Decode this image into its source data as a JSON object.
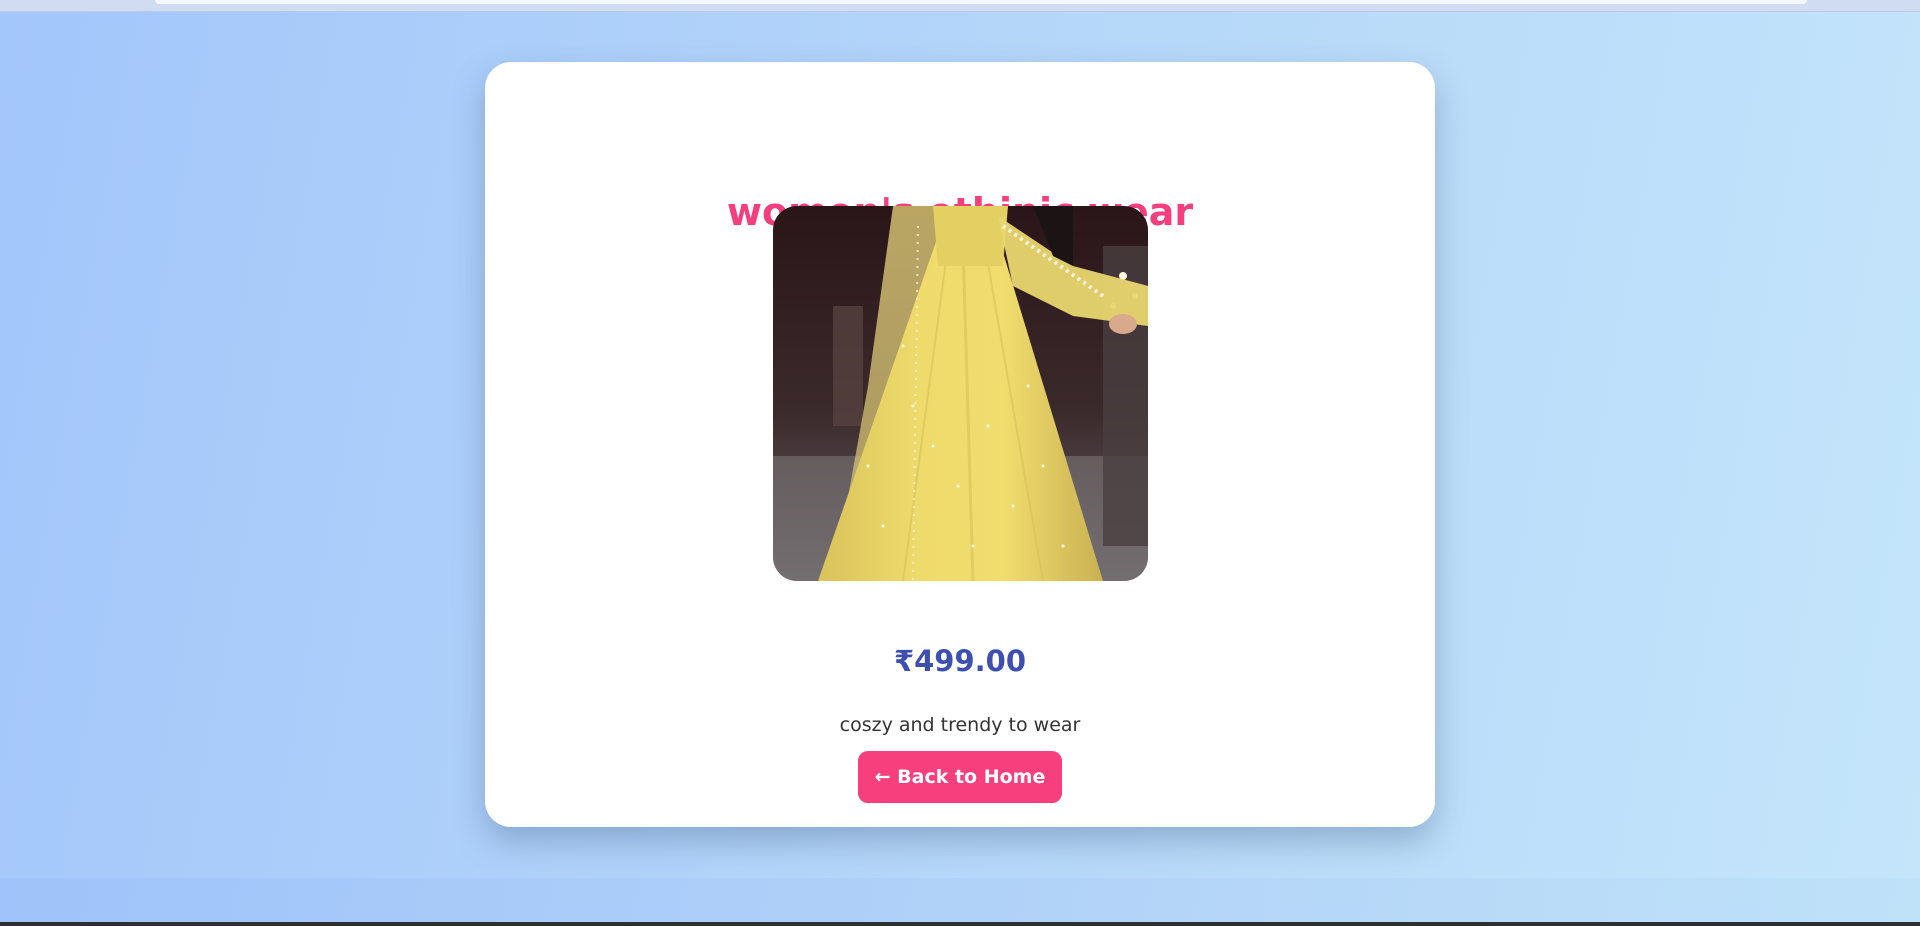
{
  "product": {
    "title": "women's ethinic wear",
    "price": "₹499.00",
    "description": "coszy and trendy to wear",
    "image_alt": "yellow anarkali dress with dupatta"
  },
  "actions": {
    "back_label": "← Back to Home"
  },
  "colors": {
    "title": "#f43f7e",
    "price": "#3d4fb0",
    "button": "#f83f7e",
    "card": "#ffffff"
  }
}
